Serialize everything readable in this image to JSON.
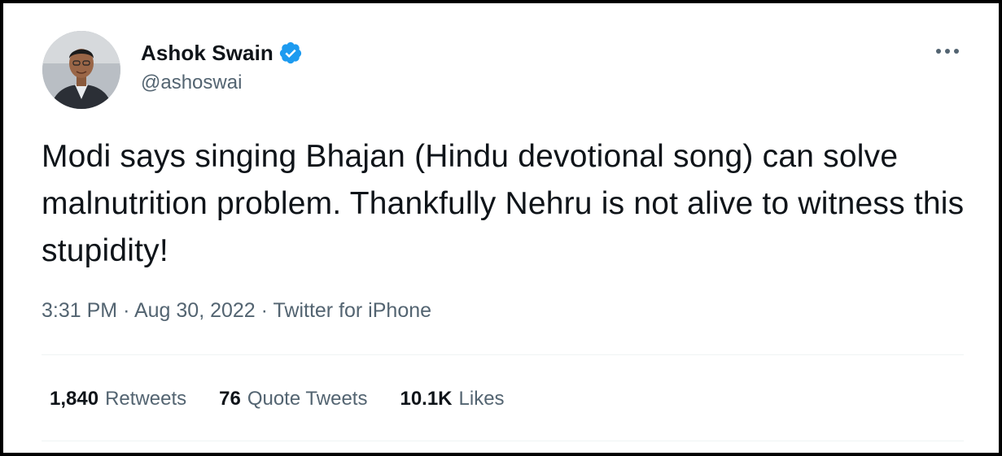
{
  "tweet": {
    "author": {
      "display_name": "Ashok Swain",
      "handle": "@ashoswai",
      "verified": true,
      "verified_icon": "verified-badge-icon"
    },
    "more_icon": "more-options-icon",
    "text": "Modi says singing Bhajan (Hindu devotional song) can solve malnutrition problem. Thankfully Nehru is not alive to witness this stupidity!",
    "meta": {
      "time": "3:31 PM",
      "separator": "·",
      "date": "Aug 30, 2022",
      "source": "Twitter for iPhone"
    },
    "stats": [
      {
        "count": "1,840",
        "label": "Retweets"
      },
      {
        "count": "76",
        "label": "Quote Tweets"
      },
      {
        "count": "10.1K",
        "label": "Likes"
      }
    ]
  },
  "colors": {
    "text_primary": "#0f1419",
    "text_secondary": "#536471",
    "verified_blue": "#1d9bf0",
    "divider": "#eff3f4",
    "frame_border": "#000000"
  }
}
